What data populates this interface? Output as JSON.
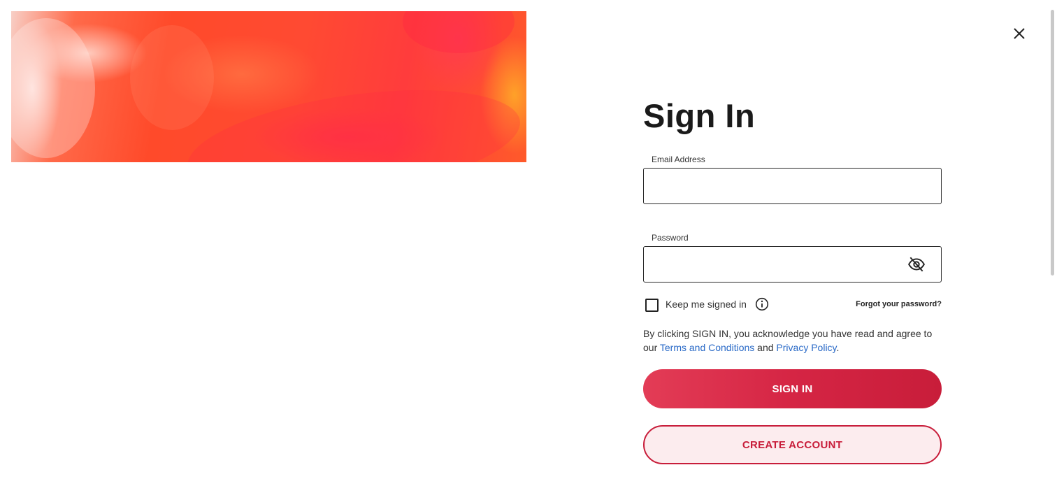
{
  "modal": {
    "title": "Sign In",
    "close_icon": "close-icon"
  },
  "hero": {
    "image": "abstract-red-orange-paint-texture"
  },
  "email": {
    "label": "Email Address",
    "value": "",
    "placeholder": ""
  },
  "password": {
    "label": "Password",
    "value": "",
    "placeholder": "",
    "toggle_icon": "eye-slash-icon"
  },
  "remember": {
    "label": "Keep me signed in",
    "checked": false,
    "info_icon": "info-icon"
  },
  "forgot": {
    "label": "Forgot your password?"
  },
  "legal": {
    "prefix": "By clicking SIGN IN, you acknowledge you have read and agree to our ",
    "terms_link": "Terms and Conditions",
    "and": " and ",
    "privacy_link": "Privacy Policy",
    "suffix": "."
  },
  "actions": {
    "sign_in": "SIGN IN",
    "create_account": "CREATE ACCOUNT"
  },
  "colors": {
    "primary": "#d52544",
    "link": "#2a6ac7",
    "secondary_bg": "#fcecee"
  }
}
